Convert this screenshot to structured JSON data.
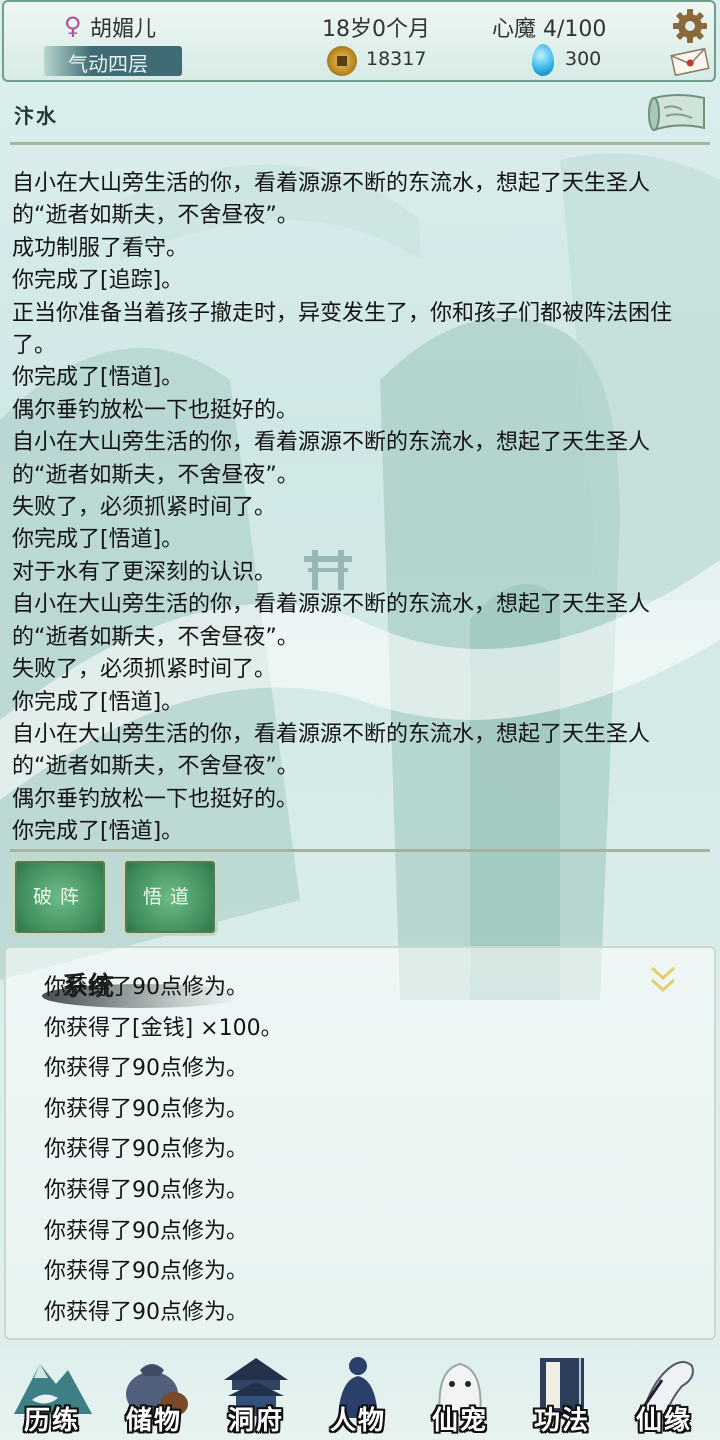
{
  "header": {
    "name": "胡媚儿",
    "gender_symbol": "♀",
    "age": "18岁0个月",
    "heart_demon": "心魔 4/100",
    "realm": "气动四层",
    "coins": "18317",
    "spirit_stones": "300"
  },
  "location": {
    "name": "汴水"
  },
  "story_log": [
    "自小在大山旁生活的你，看着源源不断的东流水，想起了天生圣人的“逝者如斯夫，不舍昼夜”。",
    "成功制服了看守。",
    "你完成了[追踪]。",
    "正当你准备当着孩子撤走时，异变发生了，你和孩子们都被阵法困住了。",
    "你完成了[悟道]。",
    "偶尔垂钓放松一下也挺好的。",
    "自小在大山旁生活的你，看着源源不断的东流水，想起了天生圣人的“逝者如斯夫，不舍昼夜”。",
    "失败了，必须抓紧时间了。",
    "你完成了[悟道]。",
    "对于水有了更深刻的认识。",
    "自小在大山旁生活的你，看着源源不断的东流水，想起了天生圣人的“逝者如斯夫，不舍昼夜”。",
    "失败了，必须抓紧时间了。",
    "你完成了[悟道]。",
    "自小在大山旁生活的你，看着源源不断的东流水，想起了天生圣人的“逝者如斯夫，不舍昼夜”。",
    "偶尔垂钓放松一下也挺好的。",
    "你完成了[悟道]。"
  ],
  "actions": {
    "break_array": "破阵",
    "enlighten": "悟道"
  },
  "system": {
    "title": "系统",
    "messages": [
      "你获得了90点修为。",
      "你获得了[金钱] ×100。",
      "你获得了90点修为。",
      "你获得了90点修为。",
      "你获得了90点修为。",
      "你获得了90点修为。",
      "你获得了90点修为。",
      "你获得了90点修为。",
      "你获得了90点修为。"
    ]
  },
  "nav": [
    {
      "label": "历练",
      "icon": "mountain-icon"
    },
    {
      "label": "储物",
      "icon": "bag-icon"
    },
    {
      "label": "洞府",
      "icon": "pavilion-icon"
    },
    {
      "label": "人物",
      "icon": "person-icon"
    },
    {
      "label": "仙宠",
      "icon": "ghost-pet-icon"
    },
    {
      "label": "功法",
      "icon": "book-icon"
    },
    {
      "label": "仙缘",
      "icon": "crane-icon"
    }
  ],
  "colors": {
    "accent_green": "#3f8d5c",
    "realm_bar": "#3f6b75",
    "female_symbol": "#b04f9a"
  }
}
